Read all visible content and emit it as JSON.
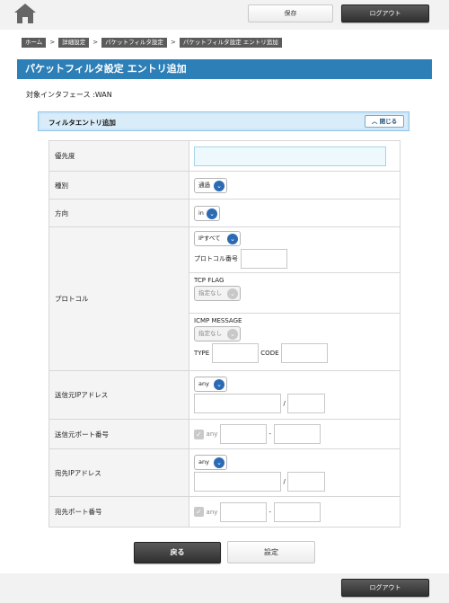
{
  "header": {
    "save_label": "保存",
    "logout_label": "ログアウト"
  },
  "breadcrumb": [
    "ホーム",
    "詳細設定",
    "パケットフィルタ設定",
    "パケットフィルタ設定 エントリ追加"
  ],
  "breadcrumb_separator": ">",
  "page_title": "パケットフィルタ設定 エントリ追加",
  "interface_text": "対象インタフェース :WAN",
  "section": {
    "title": "フィルタエントリ追加",
    "close_label": "閉じる"
  },
  "form": {
    "priority": {
      "label": "優先度",
      "value": ""
    },
    "type": {
      "label": "種別",
      "selected": "通過"
    },
    "direction": {
      "label": "方向",
      "selected": "in"
    },
    "protocol": {
      "label": "プロトコル",
      "selected": "IPすべて",
      "number_label": "プロトコル番号",
      "tcp_flag_label": "TCP FLAG",
      "tcp_flag_selected": "指定なし",
      "icmp_label": "ICMP MESSAGE",
      "icmp_selected": "指定なし",
      "type_label": "TYPE",
      "code_label": "CODE"
    },
    "src_ip": {
      "label": "送信元IPアドレス",
      "selected": "any",
      "slash": "/"
    },
    "src_port": {
      "label": "送信元ポート番号",
      "any_label": "any",
      "dash": "-"
    },
    "dst_ip": {
      "label": "宛先IPアドレス",
      "selected": "any",
      "slash": "/"
    },
    "dst_port": {
      "label": "宛先ポート番号",
      "any_label": "any",
      "dash": "-"
    }
  },
  "buttons": {
    "back_label": "戻る",
    "set_label": "設定"
  },
  "footer": {
    "logout_label": "ログアウト"
  },
  "colors": {
    "title_bar": "#2d7fb8",
    "section_bg": "#d9ecf9",
    "select_chevron": "#2a6bb4",
    "dark_button": "#3a3a3a"
  }
}
